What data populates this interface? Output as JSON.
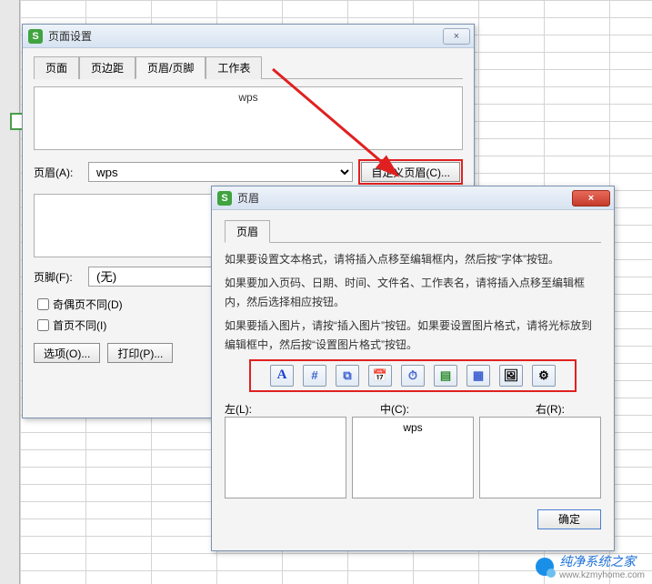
{
  "dlg1": {
    "title": "页面设置",
    "close_label": "×",
    "tabs": [
      "页面",
      "页边距",
      "页眉/页脚",
      "工作表"
    ],
    "active_tab": 2,
    "preview_text": "wps",
    "header_label": "页眉(A):",
    "header_value": "wps",
    "custom_header_btn": "自定义页眉(C)...",
    "footer_label": "页脚(F):",
    "footer_value": "(无)",
    "chk_oddeven": "奇偶页不同(D)",
    "chk_firstpage": "首页不同(I)",
    "options_btn": "选项(O)...",
    "print_btn": "打印(P)..."
  },
  "dlg2": {
    "title": "页眉",
    "close_label": "×",
    "tab_label": "页眉",
    "instr1": "如果要设置文本格式，请将插入点移至编辑框内，然后按“字体”按钮。",
    "instr2": "如果要加入页码、日期、时间、文件名、工作表名，请将插入点移至编辑框内，然后选择相应按钮。",
    "instr3": "如果要插入图片，请按“插入图片”按钮。如果要设置图片格式，请将光标放到编辑框中，然后按“设置图片格式”按钮。",
    "toolbar_icons": [
      "font-icon",
      "page-number-icon",
      "total-pages-icon",
      "date-icon",
      "time-icon",
      "filepath-icon",
      "sheetname-icon",
      "insert-image-icon",
      "image-format-icon"
    ],
    "left_label": "左(L):",
    "center_label": "中(C):",
    "right_label": "右(R):",
    "center_value": "wps",
    "ok_btn": "确定"
  },
  "watermark": {
    "brand": "纯净系统之家",
    "url": "www.kzmyhome.com"
  }
}
